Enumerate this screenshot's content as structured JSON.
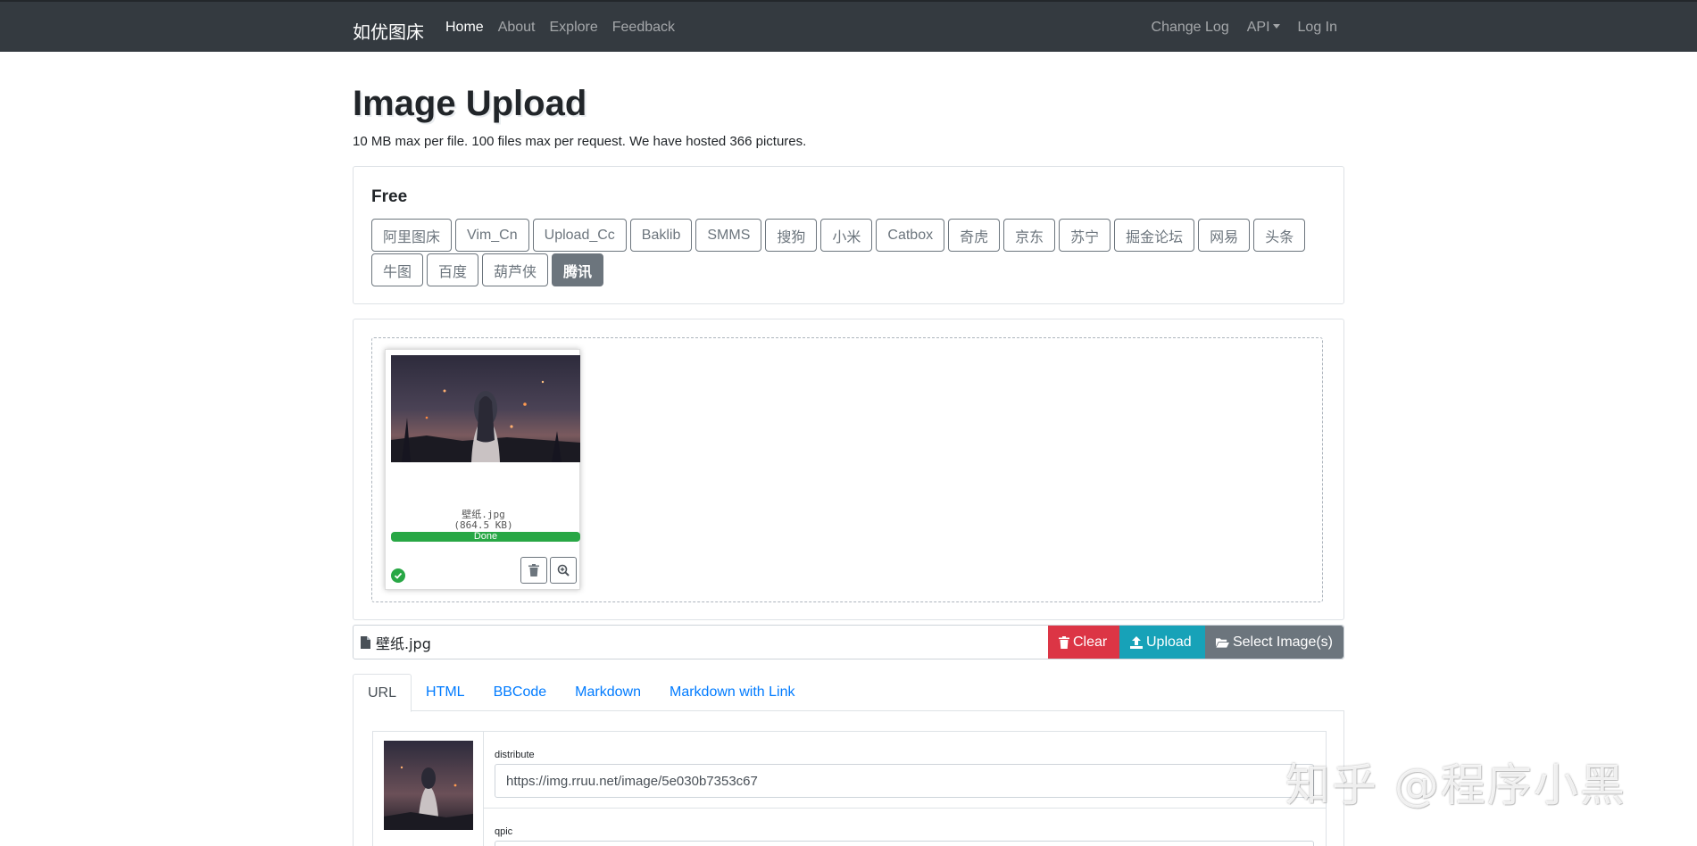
{
  "navbar": {
    "brand": "如优图床",
    "left_links": [
      "Home",
      "About",
      "Explore",
      "Feedback"
    ],
    "right_links": {
      "changelog": "Change Log",
      "api": "API",
      "login": "Log In"
    }
  },
  "header": {
    "title": "Image Upload",
    "subtitle": "10 MB max per file. 100 files max per request. We have hosted 366 pictures."
  },
  "free_hosts": {
    "title": "Free",
    "hosts": [
      "阿里图床",
      "Vim_Cn",
      "Upload_Cc",
      "Baklib",
      "SMMS",
      "搜狗",
      "小米",
      "Catbox",
      "奇虎",
      "京东",
      "苏宁",
      "掘金论坛",
      "网易",
      "头条",
      "牛图",
      "百度",
      "葫芦侠",
      "腾讯"
    ],
    "selected": "腾讯"
  },
  "upload_preview": {
    "file_name": "壁纸.jpg",
    "file_size": "(864.5 KB)",
    "progress_label": "Done",
    "progress": 1.0
  },
  "file_input": {
    "caption": "壁纸.jpg",
    "clear_label": "Clear",
    "upload_label": "Upload",
    "select_label": "Select Image(s)"
  },
  "result_tabs": [
    "URL",
    "HTML",
    "BBCode",
    "Markdown",
    "Markdown with Link"
  ],
  "results": {
    "rows": [
      {
        "label": "distribute",
        "url": "https://img.rruu.net/image/5e030b7353c67"
      },
      {
        "label": "qpic",
        "url": ""
      }
    ]
  },
  "watermark": "知乎 @程序小黑",
  "colors": {
    "navbar": "#343a40",
    "clear": "#dc3545",
    "upload": "#17a2b8",
    "select": "#6c757d",
    "success": "#28a745",
    "link": "#007bff"
  },
  "icons": [
    "file-icon",
    "trash-icon",
    "upload-icon",
    "folder-open-icon",
    "check-circle-icon",
    "zoom-in-icon"
  ]
}
